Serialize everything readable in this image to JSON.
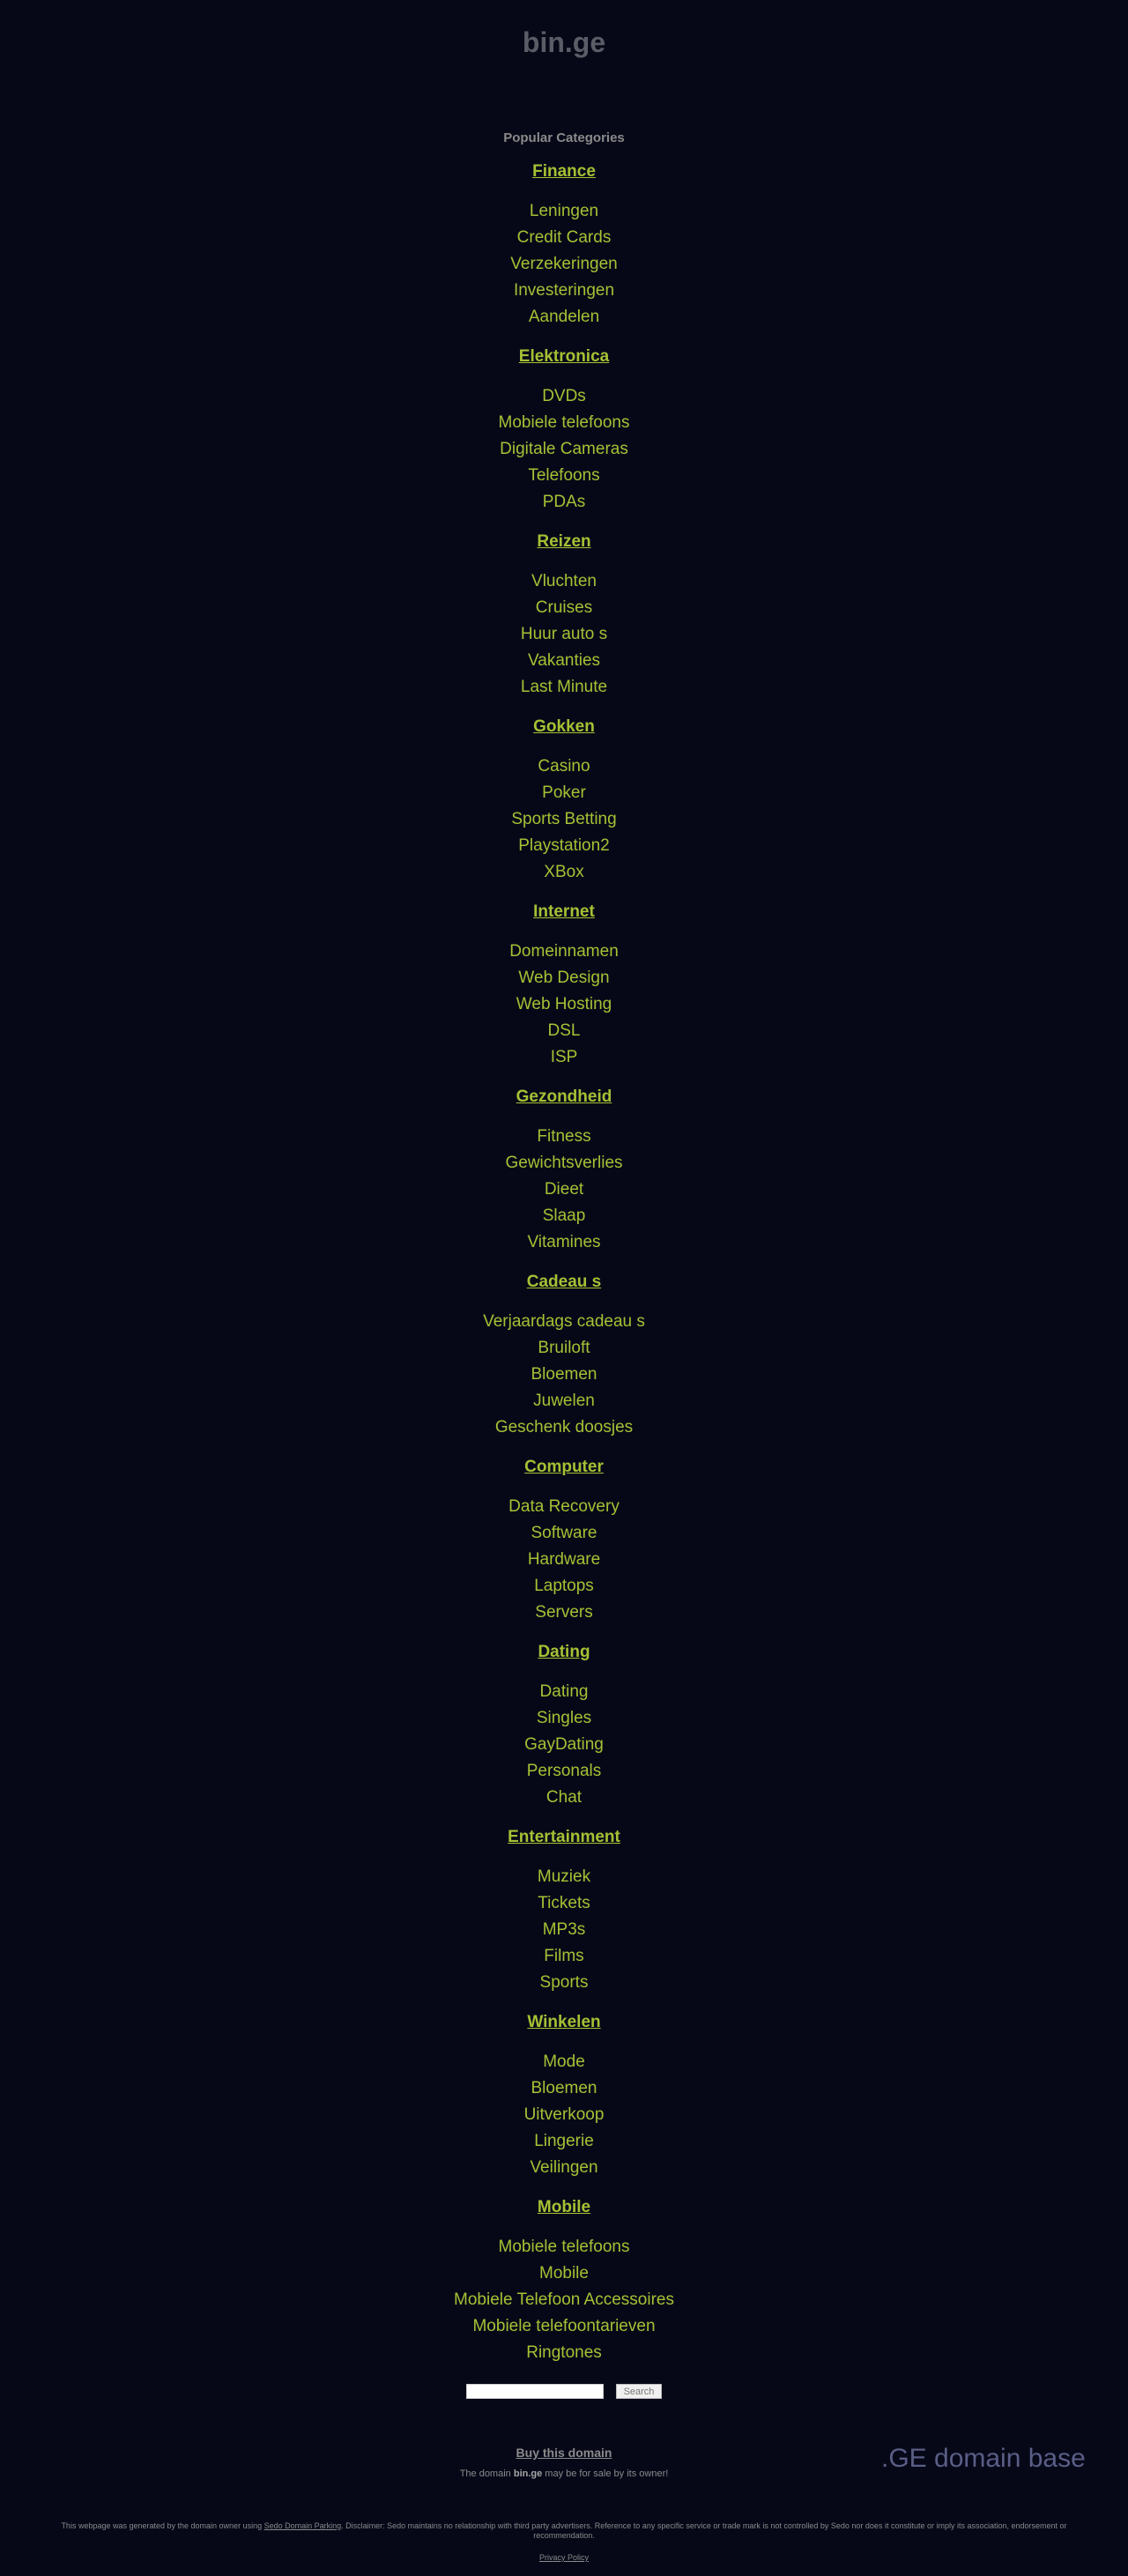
{
  "site": {
    "title": "bin.ge"
  },
  "popular_heading": "Popular Categories",
  "categories": [
    {
      "title": "Finance",
      "items": [
        "Leningen",
        "Credit Cards",
        "Verzekeringen",
        "Investeringen",
        "Aandelen"
      ]
    },
    {
      "title": "Elektronica",
      "items": [
        "DVDs",
        "Mobiele telefoons",
        "Digitale Cameras",
        "Telefoons",
        "PDAs"
      ]
    },
    {
      "title": "Reizen",
      "items": [
        "Vluchten",
        "Cruises",
        "Huur auto s",
        "Vakanties",
        "Last Minute"
      ]
    },
    {
      "title": "Gokken",
      "items": [
        "Casino",
        "Poker",
        "Sports Betting",
        "Playstation2",
        "XBox"
      ]
    },
    {
      "title": "Internet",
      "items": [
        "Domeinnamen",
        "Web Design",
        "Web Hosting",
        "DSL",
        "ISP"
      ]
    },
    {
      "title": "Gezondheid",
      "items": [
        "Fitness",
        "Gewichtsverlies",
        "Dieet",
        "Slaap",
        "Vitamines"
      ]
    },
    {
      "title": "Cadeau s",
      "items": [
        "Verjaardags cadeau s",
        "Bruiloft",
        "Bloemen",
        "Juwelen",
        "Geschenk doosjes"
      ]
    },
    {
      "title": "Computer",
      "items": [
        "Data Recovery",
        "Software",
        "Hardware",
        "Laptops",
        "Servers"
      ]
    },
    {
      "title": "Dating",
      "items": [
        "Dating",
        "Singles",
        "GayDating",
        "Personals",
        "Chat"
      ]
    },
    {
      "title": "Entertainment",
      "items": [
        "Muziek",
        "Tickets",
        "MP3s",
        "Films",
        "Sports"
      ]
    },
    {
      "title": "Winkelen",
      "items": [
        "Mode",
        "Bloemen",
        "Uitverkoop",
        "Lingerie",
        "Veilingen"
      ]
    },
    {
      "title": "Mobile",
      "items": [
        "Mobiele telefoons",
        "Mobile",
        "Mobiele Telefoon Accessoires",
        "Mobiele telefoontarieven",
        "Ringtones"
      ]
    }
  ],
  "search": {
    "input_value": "",
    "button_label": "Search"
  },
  "footer": {
    "buy_label": "Buy this domain",
    "sale_prefix": "The domain ",
    "sale_domain": "bin.ge",
    "sale_suffix": " may be for sale by its owner!",
    "domain_base": ".GE domain base",
    "disclaimer_prefix": "This webpage was generated by the domain owner using ",
    "disclaimer_link": "Sedo Domain Parking",
    "disclaimer_suffix": ". Disclaimer: Sedo maintains no relationship with third party advertisers. Reference to any specific service or trade mark is not controlled by Sedo nor does it constitute or imply its association, endorsement or recommendation.",
    "privacy_label": "Privacy Policy"
  },
  "colors": {
    "background": "#060818",
    "link": "#a7c034",
    "muted_text": "#8a8a8a",
    "domain_base": "#5a5e86"
  }
}
